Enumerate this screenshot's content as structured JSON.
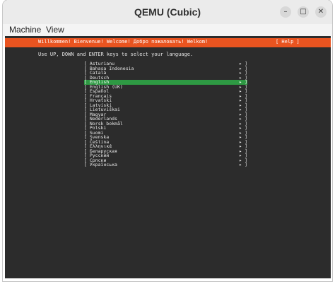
{
  "window": {
    "title": "QEMU (Cubic)",
    "minimize_icon": "minimize-icon",
    "maximize_icon": "maximize-icon",
    "close_icon": "close-icon"
  },
  "menu": [
    "Machine",
    "View"
  ],
  "installer": {
    "banner": "Willkommen! Bienvenue! Welcome! Добро пожаловать! Welkom!",
    "help": "[ Help ]",
    "instruction": "Use UP, DOWN and ENTER keys to select your language.",
    "languages": [
      "Asturianu",
      "Bahasa Indonesia",
      "Català",
      "Deutsch",
      "English",
      "English (UK)",
      "Español",
      "Français",
      "Hrvatski",
      "Latviski",
      "Lietuviškai",
      "Magyar",
      "Nederlands",
      "Norsk bokmål",
      "Polski",
      "Suomi",
      "Svenska",
      "Čeština",
      "Ελληνικά",
      "Беларуская",
      "Русский",
      "Српски",
      "Українська"
    ],
    "selected_index": 4,
    "colors": {
      "banner": "#e95420",
      "selected": "#2e9943",
      "background": "#2c2c2c"
    }
  }
}
